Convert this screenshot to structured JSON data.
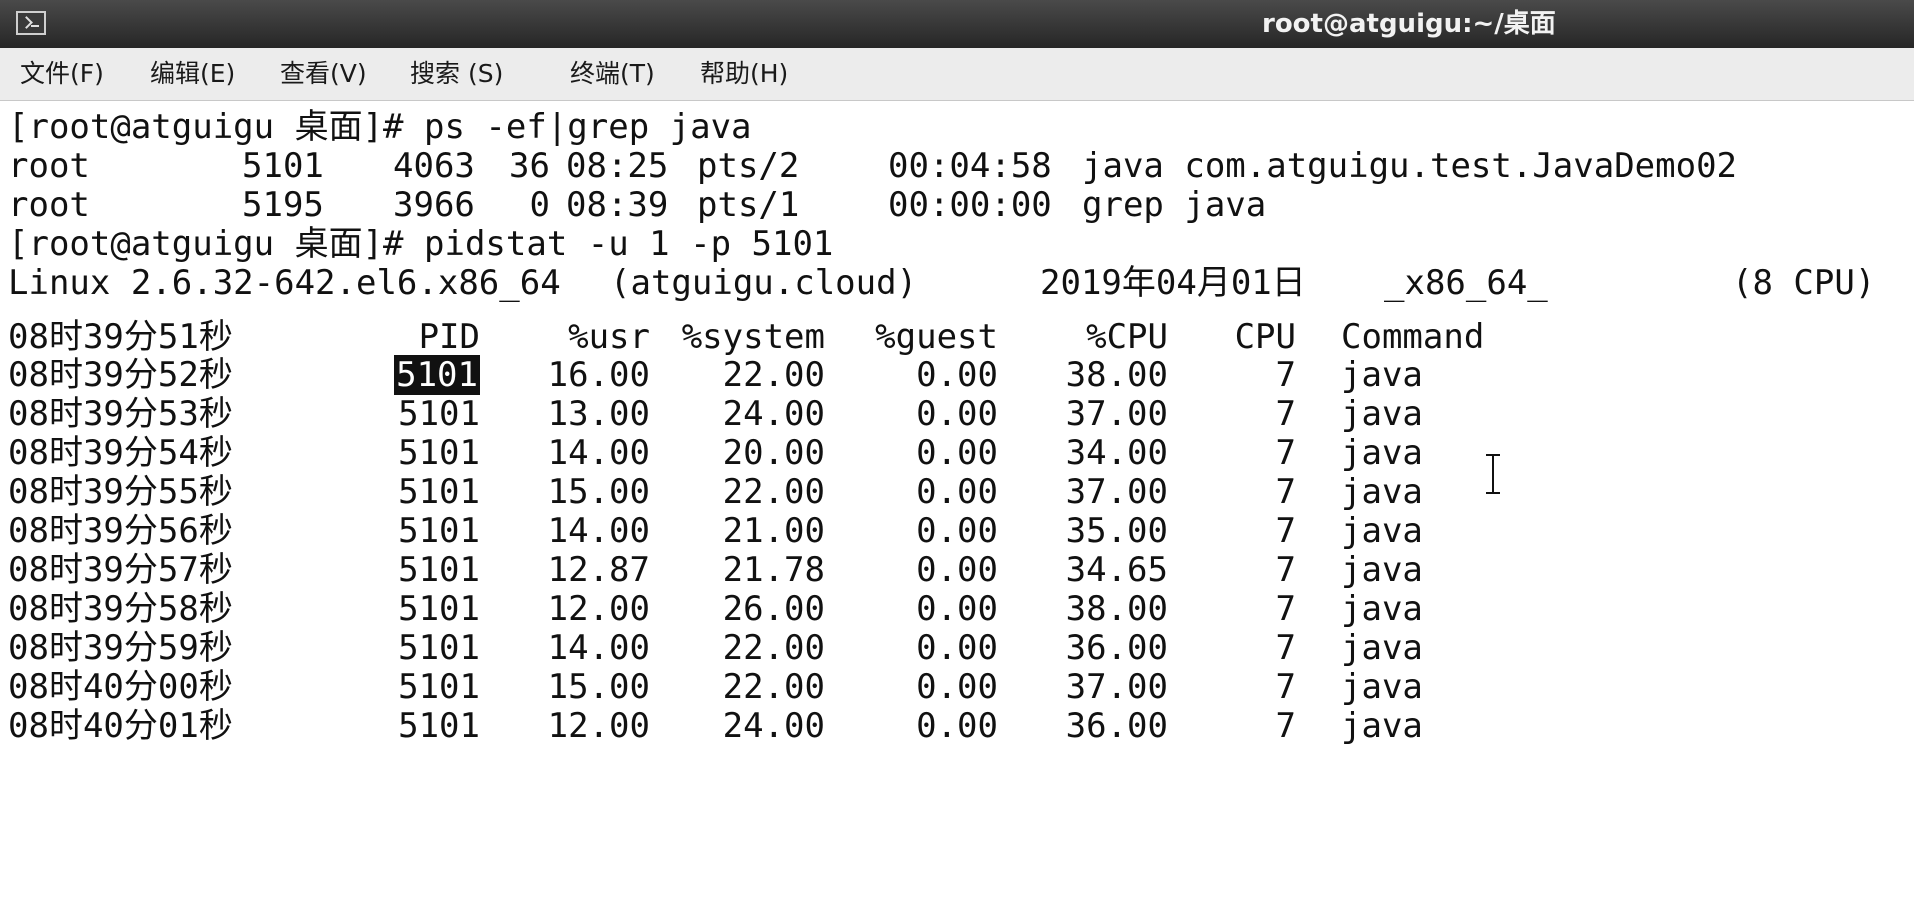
{
  "window": {
    "title": "root@atguigu:~/桌面",
    "icon": "terminal-icon"
  },
  "menu": {
    "items": [
      "文件(F)",
      "编辑(E)",
      "查看(V)",
      "搜索 (S)",
      "终端(T)",
      "帮助(H)"
    ]
  },
  "terminal": {
    "prompt1": "[root@atguigu 桌面]# ",
    "command1": "ps -ef|grep java",
    "ps_rows": [
      {
        "user": "root",
        "pid": "5101",
        "ppid": "4063",
        "c": "36",
        "stime": "08:25",
        "tty": "pts/2",
        "time": "00:04:58",
        "cmd": "java com.atguigu.test.JavaDemo02"
      },
      {
        "user": "root",
        "pid": "5195",
        "ppid": "3966",
        "c": "0",
        "stime": "08:39",
        "tty": "pts/1",
        "time": "00:00:00",
        "cmd": "grep java"
      }
    ],
    "prompt2": "[root@atguigu 桌面]# ",
    "command2": "pidstat -u 1 -p 5101",
    "sysinfo": {
      "kernel": "Linux 2.6.32-642.el6.x86_64",
      "host": "(atguigu.cloud)",
      "date": "2019年04月01日",
      "arch": "_x86_64_",
      "cpus": "(8 CPU)"
    },
    "pidstat_header": {
      "time": "08时39分51秒",
      "pid": "PID",
      "usr": "%usr",
      "system": "%system",
      "guest": "%guest",
      "cpu_pct": "%CPU",
      "cpu": "CPU",
      "command": "Command"
    },
    "pidstat_rows": [
      {
        "time": "08时39分52秒",
        "pid": "5101",
        "usr": "16.00",
        "system": "22.00",
        "guest": "0.00",
        "cpu_pct": "38.00",
        "cpu": "7",
        "command": "java"
      },
      {
        "time": "08时39分53秒",
        "pid": "5101",
        "usr": "13.00",
        "system": "24.00",
        "guest": "0.00",
        "cpu_pct": "37.00",
        "cpu": "7",
        "command": "java"
      },
      {
        "time": "08时39分54秒",
        "pid": "5101",
        "usr": "14.00",
        "system": "20.00",
        "guest": "0.00",
        "cpu_pct": "34.00",
        "cpu": "7",
        "command": "java"
      },
      {
        "time": "08时39分55秒",
        "pid": "5101",
        "usr": "15.00",
        "system": "22.00",
        "guest": "0.00",
        "cpu_pct": "37.00",
        "cpu": "7",
        "command": "java"
      },
      {
        "time": "08时39分56秒",
        "pid": "5101",
        "usr": "14.00",
        "system": "21.00",
        "guest": "0.00",
        "cpu_pct": "35.00",
        "cpu": "7",
        "command": "java"
      },
      {
        "time": "08时39分57秒",
        "pid": "5101",
        "usr": "12.87",
        "system": "21.78",
        "guest": "0.00",
        "cpu_pct": "34.65",
        "cpu": "7",
        "command": "java"
      },
      {
        "time": "08时39分58秒",
        "pid": "5101",
        "usr": "12.00",
        "system": "26.00",
        "guest": "0.00",
        "cpu_pct": "38.00",
        "cpu": "7",
        "command": "java"
      },
      {
        "time": "08时39分59秒",
        "pid": "5101",
        "usr": "14.00",
        "system": "22.00",
        "guest": "0.00",
        "cpu_pct": "36.00",
        "cpu": "7",
        "command": "java"
      },
      {
        "time": "08时40分00秒",
        "pid": "5101",
        "usr": "15.00",
        "system": "22.00",
        "guest": "0.00",
        "cpu_pct": "37.00",
        "cpu": "7",
        "command": "java"
      },
      {
        "time": "08时40分01秒",
        "pid": "5101",
        "usr": "12.00",
        "system": "24.00",
        "guest": "0.00",
        "cpu_pct": "36.00",
        "cpu": "7",
        "command": "java"
      }
    ],
    "selected_text": "5101"
  }
}
